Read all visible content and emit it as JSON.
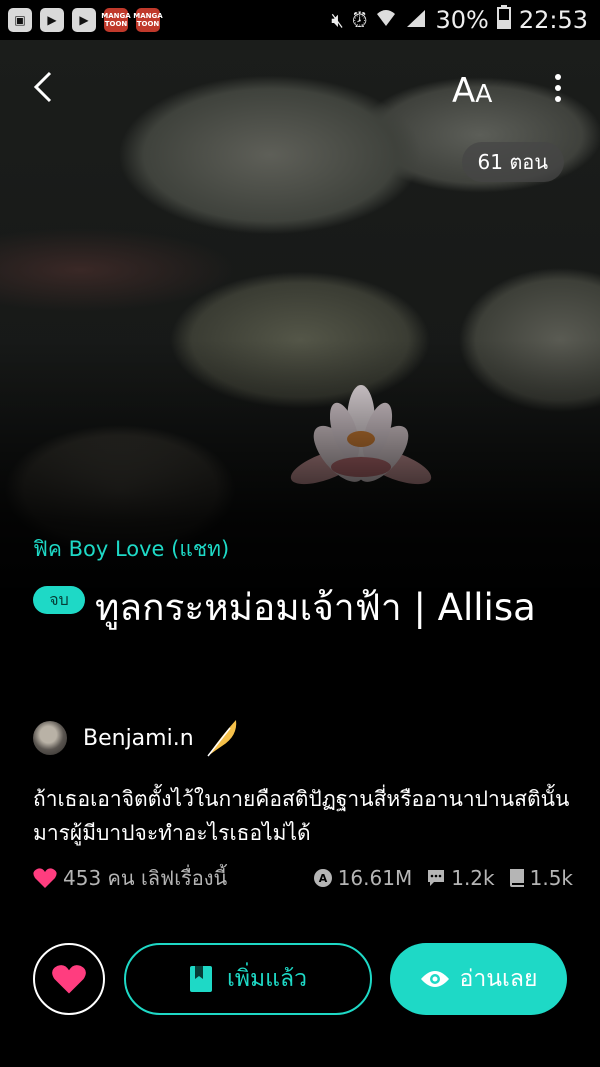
{
  "status_bar": {
    "left_icons": [
      "app-icon",
      "play-icon",
      "play-icon",
      "mangatoon-icon",
      "mangatoon-icon"
    ],
    "mangatoon_label": "MANGA TOON",
    "battery": "30%",
    "time": "22:53"
  },
  "header": {
    "font_size_label_big": "A",
    "font_size_label_small": "A",
    "episodes": "61 ตอน"
  },
  "story": {
    "genre": "ฟิค Boy Love (แชท)",
    "status": "จบ",
    "title": "ทูลกระหม่อมเจ้าฟ้า | Allisa",
    "author": "Benjami.n",
    "synopsis": "ถ้าเธอเอาจิตตั้งไว้ในกายคือสติปัฏฐานสี่หรืออานาปานสตินั้น มารผู้มีบาปจะทำอะไรเธอไม่ได้"
  },
  "stats": {
    "loves": "453 คน เลิฟเรื่องนี้",
    "views": "16.61M",
    "comments": "1.2k",
    "bookmarks": "1.5k"
  },
  "actions": {
    "added_label": "เพิ่มแล้ว",
    "read_label": "อ่านเลย"
  },
  "colors": {
    "accent": "#1ed9c6",
    "heart": "#ff3d7f"
  }
}
